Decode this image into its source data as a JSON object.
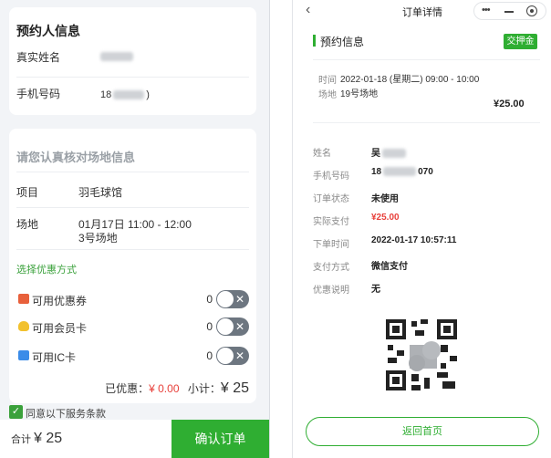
{
  "left": {
    "booker": {
      "title": "预约人信息",
      "name_label": "真实姓名",
      "phone_label": "手机号码",
      "phone_prefix": "18",
      "phone_suffix": ")"
    },
    "venue": {
      "title": "请您认真核对场地信息",
      "item_label": "项目",
      "item_value": "羽毛球馆",
      "court_label": "场地",
      "court_time": "01月17日 11:00 - 12:00",
      "court_name": "3号场地",
      "discount_heading": "选择优惠方式",
      "options": [
        {
          "icon": "coupon-icon",
          "label": "可用优惠券",
          "count": "0",
          "color": "#e8603b"
        },
        {
          "icon": "member-card-icon",
          "label": "可用会员卡",
          "count": "0",
          "color": "#f2c12e"
        },
        {
          "icon": "ic-card-icon",
          "label": "可用IC卡",
          "count": "0",
          "color": "#3b8ce8"
        }
      ],
      "discounted_label": "已优惠：",
      "discounted_value": "¥ 0.00",
      "subtotal_label": "小计：",
      "subtotal_value": "¥ 25"
    },
    "agree_text": "同意以下服务条款",
    "total_label": "合计",
    "total_value": "¥ 25",
    "confirm_label": "确认订单"
  },
  "right": {
    "nav_title": "订单详情",
    "section_title": "预约信息",
    "deposit_badge": "交押金",
    "time_label": "时间",
    "time_value": "2022-01-18 (星期二) 09:00 - 10:00",
    "court_label": "场地",
    "court_value": "19号场地",
    "price": "¥25.00",
    "details": [
      {
        "key": "姓名",
        "value": "吴"
      },
      {
        "key": "手机号码",
        "value": "18",
        "suffix": "070"
      },
      {
        "key": "订单状态",
        "value": "未使用"
      },
      {
        "key": "实际支付",
        "value": "¥25.00"
      },
      {
        "key": "下单时间",
        "value": "2022-01-17 10:57:11"
      },
      {
        "key": "支付方式",
        "value": "微信支付"
      },
      {
        "key": "优惠说明",
        "value": "无"
      }
    ],
    "home_button": "返回首页"
  }
}
